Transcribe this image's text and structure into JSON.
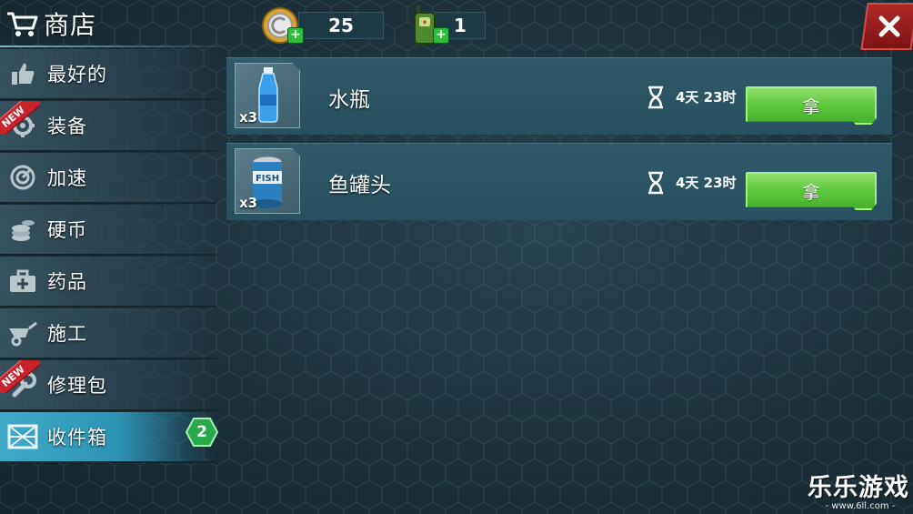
{
  "header": {
    "title": "商店",
    "coins": {
      "value": "25",
      "icon": "coin-icon"
    },
    "tokens": {
      "value": "1",
      "icon": "walkie-talkie-icon"
    },
    "close_icon": "close-icon"
  },
  "sidebar": {
    "items": [
      {
        "label": "最好的",
        "icon": "thumbs-up-icon",
        "is_new": false,
        "active": false
      },
      {
        "label": "装备",
        "icon": "gear-parts-icon",
        "is_new": true,
        "active": false
      },
      {
        "label": "加速",
        "icon": "speed-dial-icon",
        "is_new": false,
        "active": false
      },
      {
        "label": "硬币",
        "icon": "coins-stack-icon",
        "is_new": false,
        "active": false
      },
      {
        "label": "药品",
        "icon": "medkit-icon",
        "is_new": false,
        "active": false
      },
      {
        "label": "施工",
        "icon": "wheelbarrow-icon",
        "is_new": false,
        "active": false
      },
      {
        "label": "修理包",
        "icon": "wrench-icon",
        "is_new": true,
        "active": false
      },
      {
        "label": "收件箱",
        "icon": "crate-icon",
        "is_new": false,
        "active": true,
        "badge": "2"
      }
    ],
    "new_label": "NEW"
  },
  "items": [
    {
      "name": "水瓶",
      "count": "x3",
      "time": "4天 23时",
      "button": "拿",
      "icon": "water-bottle-icon"
    },
    {
      "name": "鱼罐头",
      "count": "x3",
      "time": "4天 23时",
      "button": "拿",
      "icon": "fish-can-icon"
    }
  ],
  "watermark": {
    "title": "乐乐游戏",
    "url": "- www.6ll.com -"
  },
  "colors": {
    "accent": "#3ea9c9",
    "take_button": "#5cc63b",
    "close_button": "#b02a2a"
  }
}
